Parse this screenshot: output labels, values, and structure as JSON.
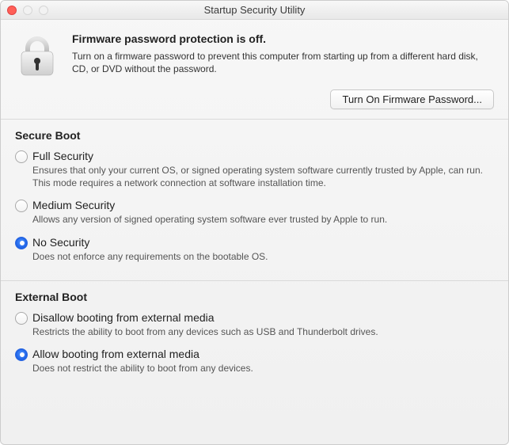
{
  "window": {
    "title": "Startup Security Utility"
  },
  "firmware": {
    "heading": "Firmware password protection is off.",
    "body": "Turn on a firmware password to prevent this computer from starting up from a different hard disk, CD, or DVD without the password.",
    "button_label": "Turn On Firmware Password..."
  },
  "secure_boot": {
    "heading": "Secure Boot",
    "options": [
      {
        "title": "Full Security",
        "desc": "Ensures that only your current OS, or signed operating system software currently trusted by Apple, can run. This mode requires a network connection at software installation time.",
        "selected": false
      },
      {
        "title": "Medium Security",
        "desc": "Allows any version of signed operating system software ever trusted by Apple to run.",
        "selected": false
      },
      {
        "title": "No Security",
        "desc": "Does not enforce any requirements on the bootable OS.",
        "selected": true
      }
    ]
  },
  "external_boot": {
    "heading": "External Boot",
    "options": [
      {
        "title": "Disallow booting from external media",
        "desc": "Restricts the ability to boot from any devices such as USB and Thunderbolt drives.",
        "selected": false
      },
      {
        "title": "Allow booting from external media",
        "desc": "Does not restrict the ability to boot from any devices.",
        "selected": true
      }
    ]
  }
}
